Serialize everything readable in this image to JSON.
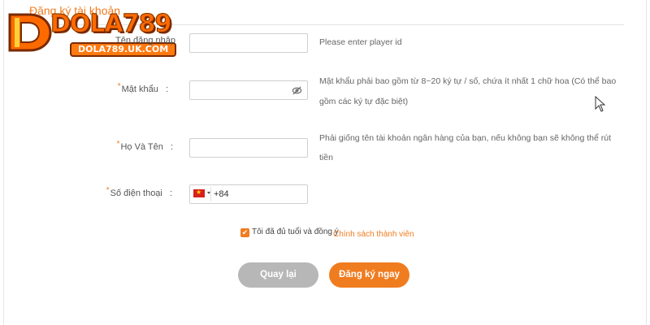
{
  "header": {
    "title": "Đăng ký tài khoản"
  },
  "logo": {
    "brand_text": "DOLA789",
    "sub_text": "DOLA789.UK.COM"
  },
  "form": {
    "username": {
      "label": "Tên đăng nhập",
      "value": "",
      "hint": "Please enter player id"
    },
    "password": {
      "label": "Mật khẩu",
      "value": "",
      "hint_line1": "Mật khẩu phải bao gồm từ 8~20 ký tự / số, chứa ít nhất 1 chữ hoa (Có thể bao",
      "hint_line2": "gồm các ký tự đặc biệt)"
    },
    "fullname": {
      "label": "Họ Và Tên",
      "value": "",
      "hint_line1": "Phải giống tên tài khoản ngân hàng của bạn, nếu không bạn sẽ không thể rút",
      "hint_line2": "tiền"
    },
    "phone": {
      "label": "Số điện thoại",
      "country_code": "+84",
      "flag_icon": "vietnam-flag-icon"
    },
    "required_mark": "*"
  },
  "agreement": {
    "checked": true,
    "text": "Tôi đã đủ tuổi và đồng ý",
    "policy_link": "Chính sách thành viên"
  },
  "buttons": {
    "back": "Quay lại",
    "register": "Đăng ký ngay"
  },
  "colors": {
    "accent": "#f07c20",
    "button_back": "#b7b7b7",
    "text": "#555555"
  }
}
